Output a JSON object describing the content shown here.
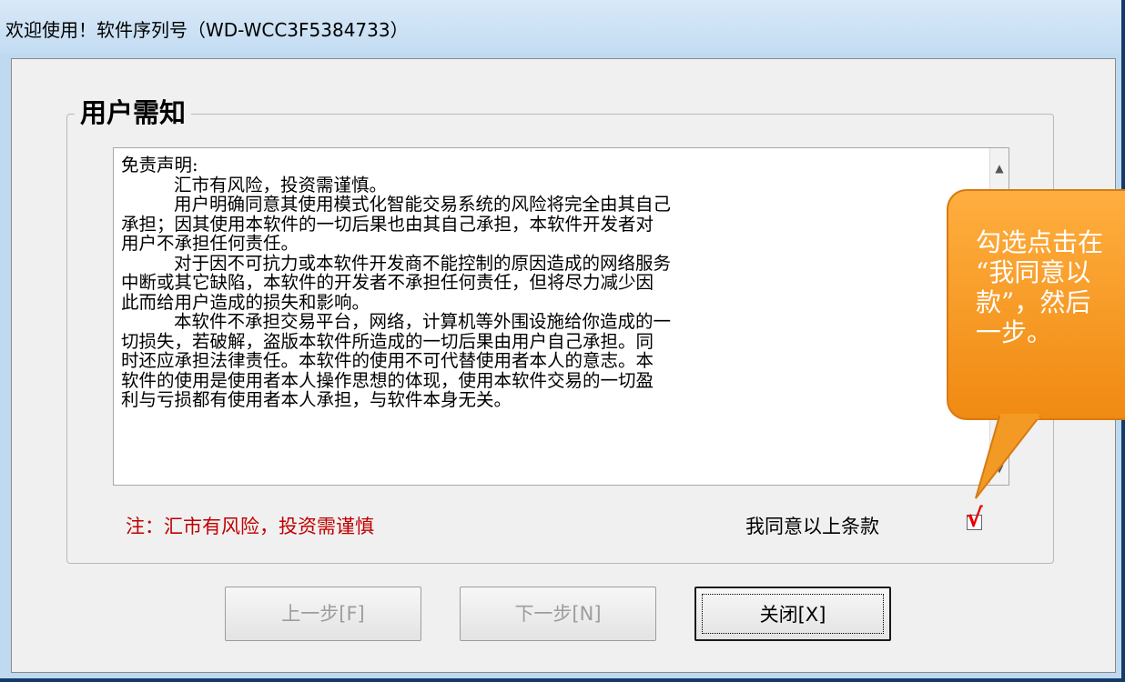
{
  "window": {
    "title": "欢迎使用！软件序列号（WD-WCC3F5384733）"
  },
  "group": {
    "title": "用户需知"
  },
  "agreement": {
    "lines": [
      "免责声明:",
      "汇市有风险，投资需谨慎。",
      "用户明确同意其使用模式化智能交易系统的风险将完全由其自己",
      "承担；因其使用本软件的一切后果也由其自己承担，本软件开发者对",
      "用户不承担任何责任。",
      "对于因不可抗力或本软件开发商不能控制的原因造成的网络服务",
      "中断或其它缺陷，本软件的开发者不承担任何责任，但将尽力减少因",
      "此而给用户造成的损失和影响。",
      "本软件不承担交易平台，网络，计算机等外围设施给你造成的一",
      "切损失，若破解，盗版本软件所造成的一切后果由用户自己承担。同",
      "时还应承担法律责任。本软件的使用不可代替使用者本人的意志。本",
      "软件的使用是使用者本人操作思想的体现，使用本软件交易的一切盈",
      "利与亏损都有使用者本人承担，与软件本身无关。"
    ]
  },
  "note": "注：汇市有风险，投资需谨慎",
  "agree": {
    "label": "我同意以上条款",
    "checked": true,
    "check_glyph": "√"
  },
  "buttons": {
    "prev": "上一步[F]",
    "next": "下一步[N]",
    "close": "关闭[X]"
  },
  "callout": {
    "lines": [
      "勾选点击在",
      "“我同意以",
      "款”，然后",
      "一步。"
    ],
    "color": "#f39a24"
  },
  "scrollbar": {
    "up_icon": "▲",
    "down_icon": "▼"
  }
}
